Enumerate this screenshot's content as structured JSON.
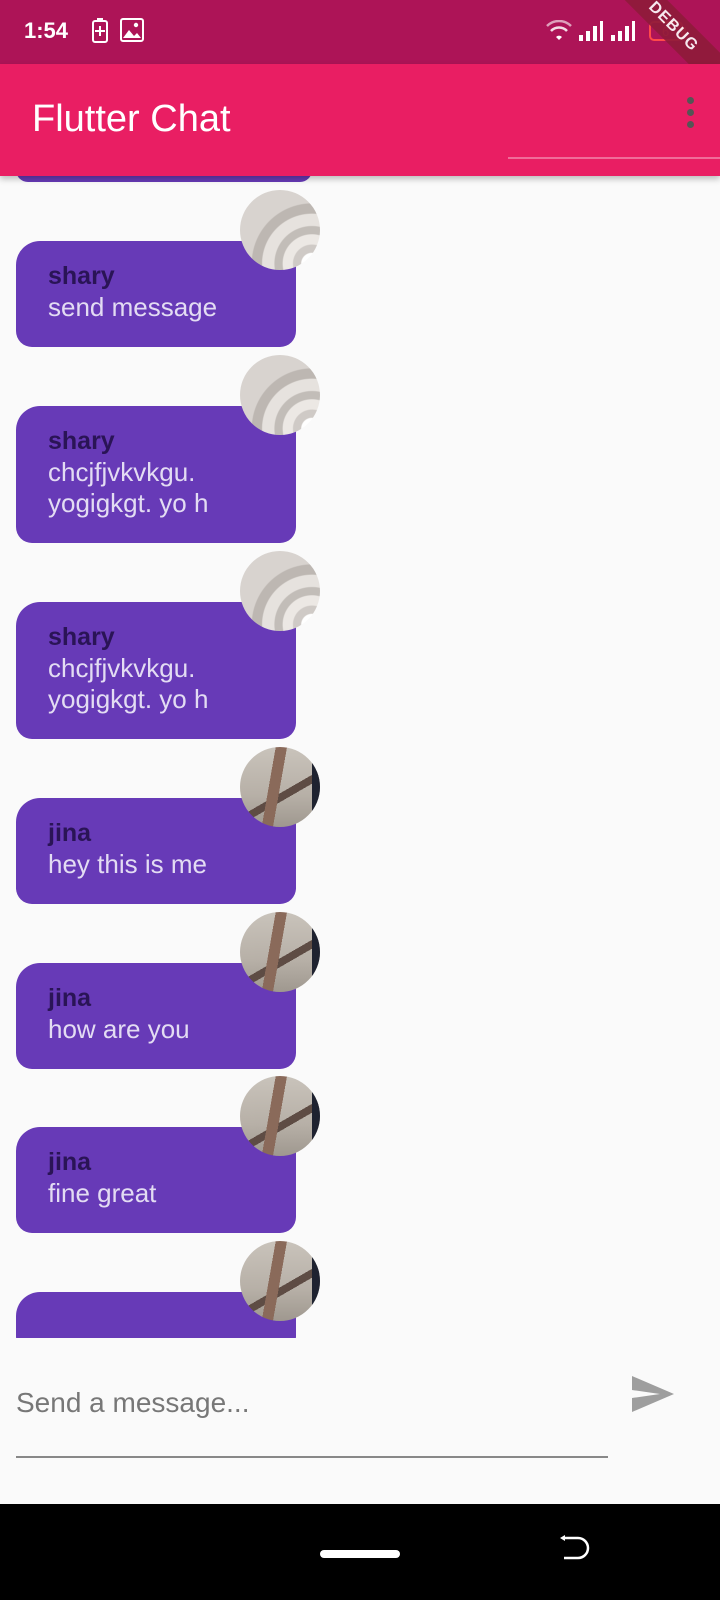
{
  "status_bar": {
    "time": "1:54",
    "battery_level": "6",
    "debug_label": "DEBUG"
  },
  "app_bar": {
    "title": "Flutter Chat"
  },
  "messages": [
    {
      "sender": "shary",
      "text": "send message",
      "avatar": "shary"
    },
    {
      "sender": "shary",
      "text": "chcjfjvkvkgu.\nyogigkgt. yo h",
      "avatar": "shary"
    },
    {
      "sender": "shary",
      "text": "chcjfjvkvkgu.\nyogigkgt. yo h",
      "avatar": "shary"
    },
    {
      "sender": "jina",
      "text": "hey this is me",
      "avatar": "jina"
    },
    {
      "sender": "jina",
      "text": "how are you",
      "avatar": "jina"
    },
    {
      "sender": "jina",
      "text": "fine great",
      "avatar": "jina"
    }
  ],
  "composer": {
    "placeholder": "Send a message...",
    "value": ""
  },
  "colors": {
    "status_bar": "#ad1457",
    "app_bar": "#e91e63",
    "bubble": "#673ab7",
    "background": "#fafafa"
  },
  "icons": {
    "status": [
      "battery-charging-icon",
      "image-icon",
      "wifi-icon",
      "signal-icon",
      "signal-icon",
      "battery-icon"
    ],
    "menu": "more-vert-icon",
    "send": "send-icon",
    "nav": [
      "home-pill",
      "rotate-icon"
    ]
  }
}
